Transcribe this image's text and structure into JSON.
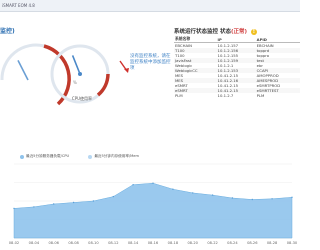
{
  "window": {
    "title": "iSMART EOM 4.8"
  },
  "corner_label": "监控)",
  "gauges": [
    {
      "value_fraction": 0.35,
      "danger_color": "#c0392b",
      "track_color": "#dfe6ee",
      "needle_color": "#6b9fd4"
    },
    {
      "value_fraction": 0.42,
      "danger_color": "#c0392b",
      "track_color": "#dfe6ee",
      "needle_color": "#4a88c8",
      "percent_text": "%",
      "caption": "CPU使用率"
    }
  ],
  "status_message": "没有监控系统，请在监控系统中添加监控项",
  "system_panel": {
    "title": "系统运行状态监控",
    "status_label": "状态",
    "status_highlight": "(正常)",
    "columns": [
      "系统名称",
      "IP",
      "APID"
    ],
    "rows": [
      [
        "EBCHAIN",
        "10.1.2.157",
        "EBCHAIN"
      ],
      [
        "T100",
        "10.1.2.156",
        "topprd"
      ],
      [
        "T100",
        "10.1.2.155",
        "toppro"
      ],
      [
        "JavisFast",
        "10.1.2.159",
        "test"
      ],
      [
        "Weblogic",
        "10.1.2.1",
        "ebr"
      ],
      [
        "WeblogicCC",
        "10.1.2.153",
        "CCAPI"
      ],
      [
        "MES",
        "10.41.2.15",
        "AMOPPROD"
      ],
      [
        "MES",
        "10.41.2.16",
        "AMESPROD"
      ],
      [
        "eSMRT",
        "10.41.2.15",
        "eSMRTPROD"
      ],
      [
        "eSMRT",
        "10.41.2.15",
        "eSMRTTEST"
      ],
      [
        "PLM",
        "10.1.2.7",
        "PLM"
      ]
    ]
  },
  "chart_data": {
    "type": "area",
    "legend": [
      "最近5分钟服务器负载/CPU",
      "最近5分钟内存使用率/Mem"
    ],
    "x": [
      "08-02",
      "08-04",
      "08-06",
      "08-08",
      "08-10",
      "08-12",
      "08-14",
      "08-16",
      "08-18",
      "08-20",
      "08-22",
      "08-24",
      "08-26",
      "08-28",
      "08-30"
    ],
    "series": [
      {
        "name": "最近5分钟服务器负载/CPU",
        "values": [
          40,
          42,
          46,
          48,
          50,
          56,
          72,
          74,
          66,
          61,
          58,
          54,
          52,
          53,
          55
        ],
        "color": "#8fc3ec"
      }
    ],
    "ylim": [
      0,
      100
    ],
    "grid": true,
    "legend_position": "top"
  }
}
